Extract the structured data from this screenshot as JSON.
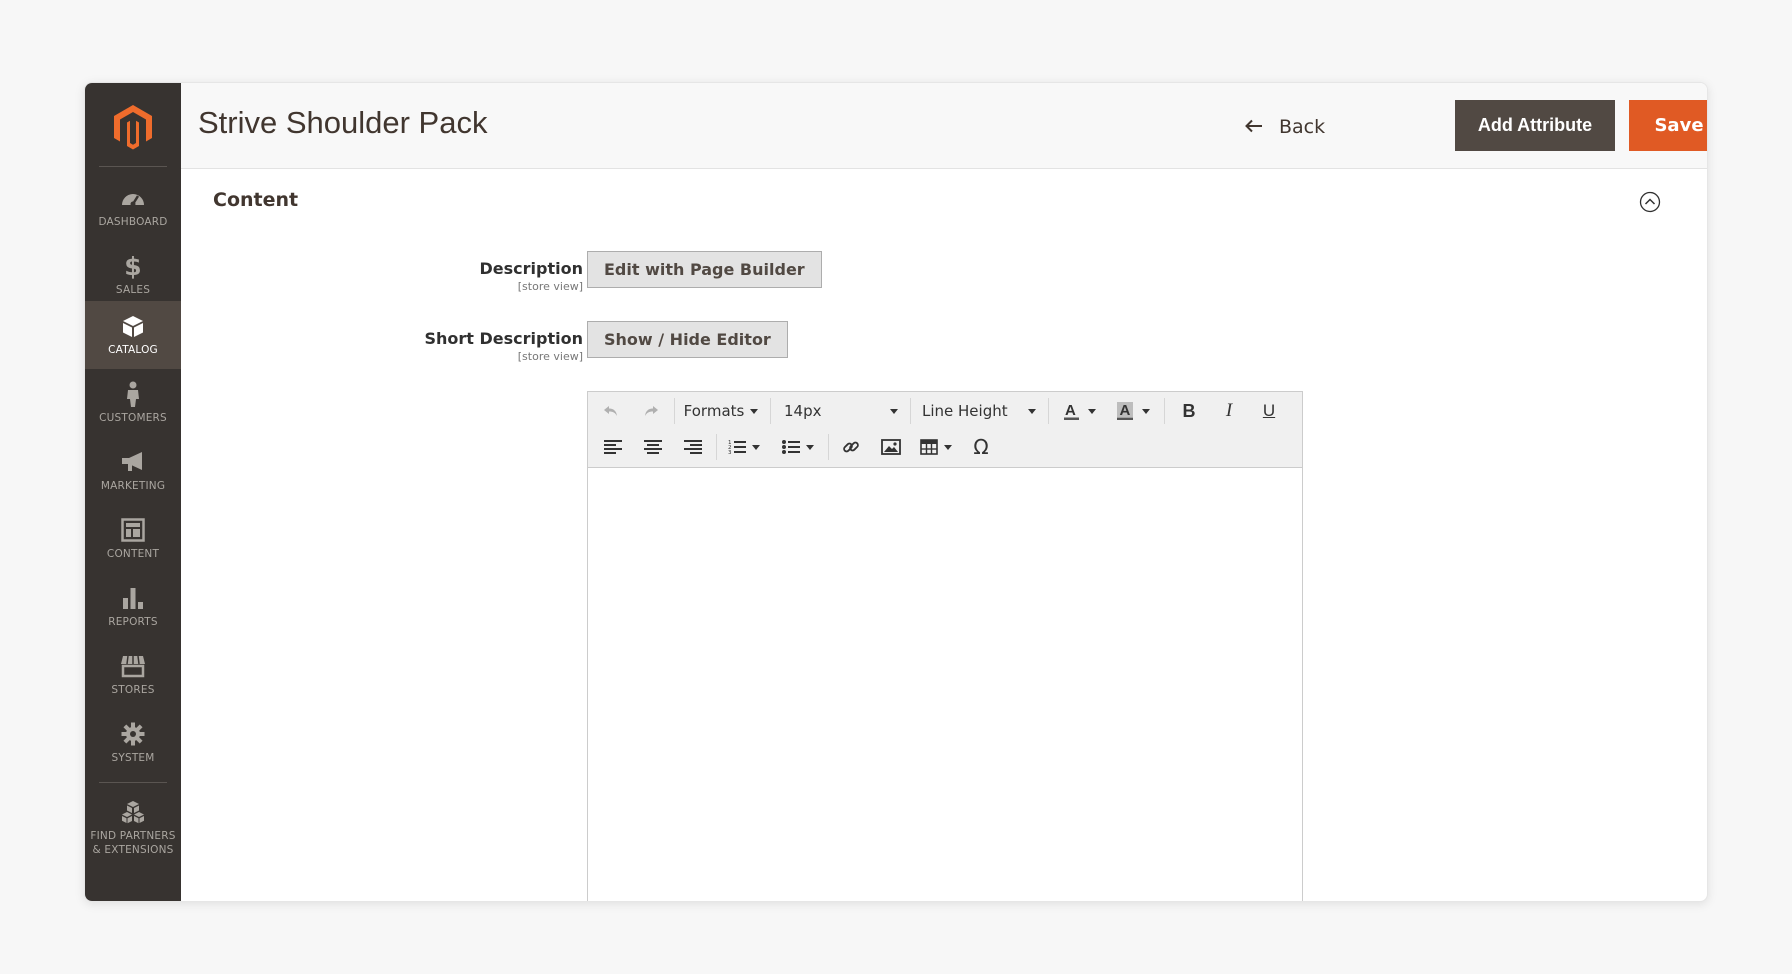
{
  "sidebar": {
    "items": [
      {
        "label": "DASHBOARD",
        "icon": "dashboard-icon"
      },
      {
        "label": "SALES",
        "icon": "dollar-icon"
      },
      {
        "label": "CATALOG",
        "icon": "box-icon"
      },
      {
        "label": "CUSTOMERS",
        "icon": "person-icon"
      },
      {
        "label": "MARKETING",
        "icon": "megaphone-icon"
      },
      {
        "label": "CONTENT",
        "icon": "layout-icon"
      },
      {
        "label": "REPORTS",
        "icon": "bar-chart-icon"
      },
      {
        "label": "STORES",
        "icon": "storefront-icon"
      },
      {
        "label": "SYSTEM",
        "icon": "gear-icon"
      }
    ],
    "extensions": {
      "line1": "FIND PARTNERS",
      "line2": "& EXTENSIONS"
    },
    "active_item": "CATALOG"
  },
  "header": {
    "title": "Strive Shoulder Pack",
    "back_label": "Back",
    "add_attribute_label": "Add Attribute",
    "save_label": "Save"
  },
  "section": {
    "title": "Content"
  },
  "fields": {
    "description": {
      "label": "Description",
      "scope": "[store view]",
      "button": "Edit with Page Builder"
    },
    "short_description": {
      "label": "Short Description",
      "scope": "[store view]",
      "button": "Show / Hide Editor"
    }
  },
  "editor": {
    "formats_label": "Formats",
    "font_size": "14px",
    "line_height_label": "Line Height",
    "content": ""
  },
  "colors": {
    "sidebar_bg": "#373330",
    "sidebar_active": "#514943",
    "accent": "#e05a24",
    "dark_button": "#514943"
  }
}
